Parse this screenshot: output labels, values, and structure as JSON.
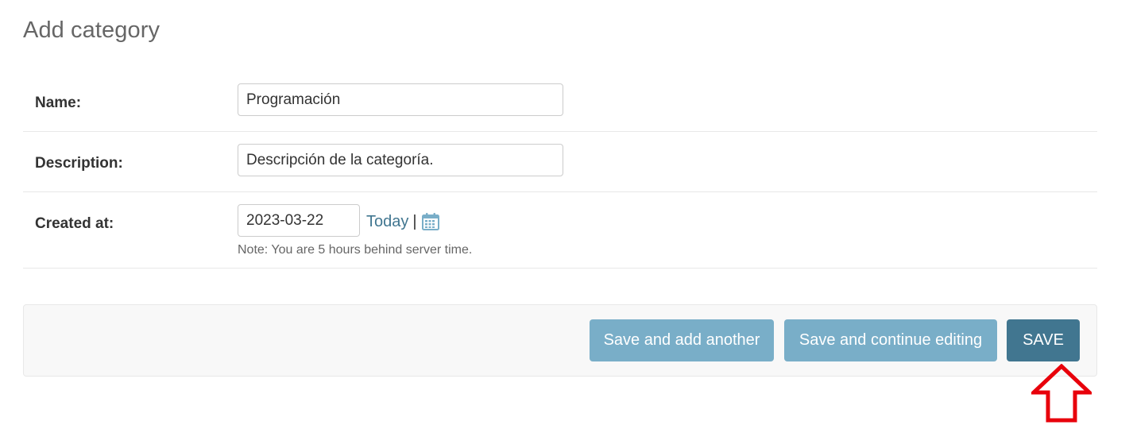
{
  "page": {
    "title": "Add category"
  },
  "form": {
    "name": {
      "label": "Name:",
      "value": "Programación"
    },
    "description": {
      "label": "Description:",
      "value": "Descripción de la categoría."
    },
    "created_at": {
      "label": "Created at:",
      "value": "2023-03-22",
      "today_link": "Today",
      "separator": "|",
      "calendar_icon": "calendar-icon",
      "note": "Note: You are 5 hours behind server time."
    }
  },
  "submit_row": {
    "save_add_another_label": "Save and add another",
    "save_continue_label": "Save and continue editing",
    "save_label": "SAVE"
  },
  "annotation": {
    "arrow_icon": "up-arrow-icon",
    "arrow_color": "#e8000b"
  },
  "colors": {
    "primary_button": "#417690",
    "secondary_button": "#79aec8",
    "link": "#417690"
  }
}
